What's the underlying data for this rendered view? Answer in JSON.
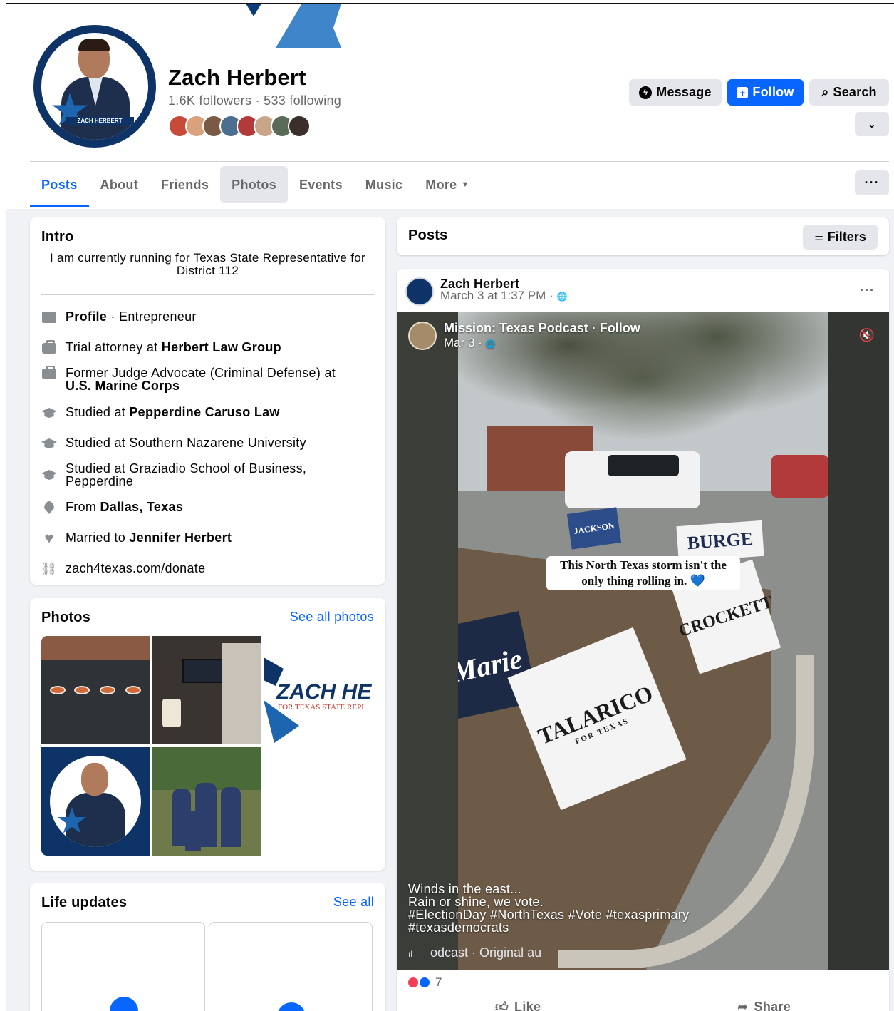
{
  "profile": {
    "name": "Zach Herbert",
    "followers_text": "1.6K followers · 533 following",
    "avatar_text": "ZACH HERBERT",
    "friend_avatar_colors": [
      "#c84b3a",
      "#d9a27c",
      "#7a5a45",
      "#4e6e8e",
      "#b23a3a",
      "#c9a58a",
      "#5b6b5a",
      "#3a2f2a"
    ]
  },
  "actions": {
    "message_label": "Message",
    "follow_label": "Follow",
    "search_label": "Search"
  },
  "tabs": [
    {
      "label": "Posts"
    },
    {
      "label": "About"
    },
    {
      "label": "Friends"
    },
    {
      "label": "Photos"
    },
    {
      "label": "Events"
    },
    {
      "label": "Music"
    },
    {
      "label": "More"
    }
  ],
  "intro": {
    "title": "Intro",
    "bio": "I am currently running for Texas State Representative for District 112",
    "items": [
      {
        "prefix": "Profile",
        "text": " · Entrepreneur"
      },
      {
        "prefix": "Trial attorney at ",
        "bold": "Herbert Law Group"
      },
      {
        "prefix": "Former Judge Advocate (Criminal Defense) at",
        "bold": "U.S. Marine Corps"
      },
      {
        "prefix": "Studied at ",
        "bold": "Pepperdine Caruso Law"
      },
      {
        "prefix": "Studied at Southern Nazarene University"
      },
      {
        "prefix": "Studied at Graziadio School of Business,",
        "line2": "Pepperdine"
      },
      {
        "prefix": "From ",
        "bold": "Dallas, Texas"
      },
      {
        "prefix": "Married to ",
        "bold": "Jennifer Herbert"
      },
      {
        "prefix": "zach4texas.com/donate"
      }
    ]
  },
  "photos": {
    "title": "Photos",
    "see_all": "See all photos",
    "logo_line1": "ZACH HEI",
    "logo_line2": "FOR TEXAS STATE REPI"
  },
  "life_updates": {
    "title": "Life updates",
    "see_all": "See all"
  },
  "posts": {
    "title": "Posts",
    "filters_label": "Filters"
  },
  "post": {
    "author": "Zach Herbert",
    "timestamp": "March 3 at 1:37 PM ·",
    "video": {
      "page_name": "Mission: Texas Podcast · Follow",
      "page_date": "Mar 3 ·",
      "bubble_text": "This North Texas storm isn't the only thing rolling in. 💙",
      "sign_burge": "BURGE",
      "sign_crockett": "CROCKETT",
      "sign_talarico": "TALARICO",
      "sign_talarico_sub": "FOR TEXAS",
      "sign_marie": "Marie",
      "sign_jackson": "JACKSON",
      "caption_line1": "Winds in the east...",
      "caption_line2": "Rain or shine, we vote.",
      "caption_line3": "#ElectionDay #NorthTexas #Vote #texasprimary",
      "caption_line4": "#texasdemocrats",
      "audio_text": "odcast · Original au"
    },
    "reaction_count": "7",
    "like_label": "Like",
    "share_label": "Share"
  }
}
